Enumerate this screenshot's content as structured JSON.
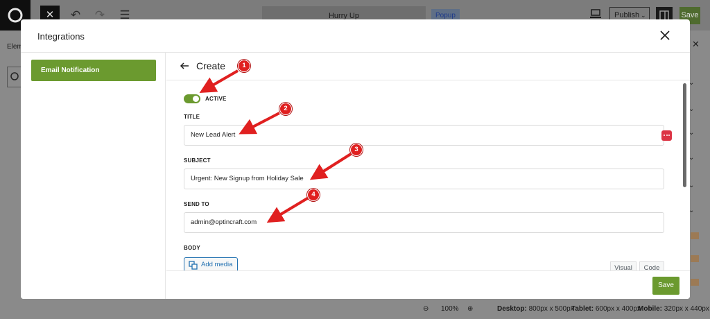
{
  "editor": {
    "close_glyph": "✕",
    "document_title": "Hurry Up",
    "type_tag": "Popup",
    "publish_label": "Publish",
    "save_label": "Save",
    "left_tab_label": "Elem",
    "right_close_glyph": "✕",
    "zoom_level": "100%",
    "viewports": [
      {
        "name": "Desktop:",
        "size": "800px x 500px"
      },
      {
        "name": "Tablet:",
        "size": "600px x 400px"
      },
      {
        "name": "Mobile:",
        "size": "320px x 440px"
      }
    ]
  },
  "modal": {
    "title": "Integrations",
    "sidebar": {
      "items": [
        {
          "label": "Email Notification",
          "active": true
        }
      ]
    },
    "create": {
      "header": "Create",
      "active": {
        "label": "ACTIVE",
        "on": true
      },
      "fields": {
        "title": {
          "label": "TITLE",
          "value": "New Lead Alert"
        },
        "subject": {
          "label": "SUBJECT",
          "value": "Urgent: New Signup from Holiday Sale"
        },
        "send_to": {
          "label": "SEND TO",
          "value": "admin@optincraft.com"
        },
        "body": {
          "label": "BODY",
          "add_media": "Add media",
          "tabs": [
            "Visual",
            "Code"
          ]
        }
      },
      "save_label": "Save"
    }
  },
  "annotations": [
    "1",
    "2",
    "3",
    "4"
  ],
  "colors": {
    "accent_green": "#6b9a2f",
    "annotation_red": "#e02020",
    "tag_red": "#dc3545",
    "link_blue": "#2271b1"
  },
  "icons": [
    "logo-icon",
    "close-icon",
    "undo-icon",
    "redo-icon",
    "list-view-icon",
    "device-preview-icon",
    "chevron-down-icon",
    "sidebar-toggle-icon",
    "search-icon",
    "back-arrow-icon",
    "more-dots-icon",
    "media-icon",
    "zoom-out-icon",
    "zoom-in-icon"
  ]
}
